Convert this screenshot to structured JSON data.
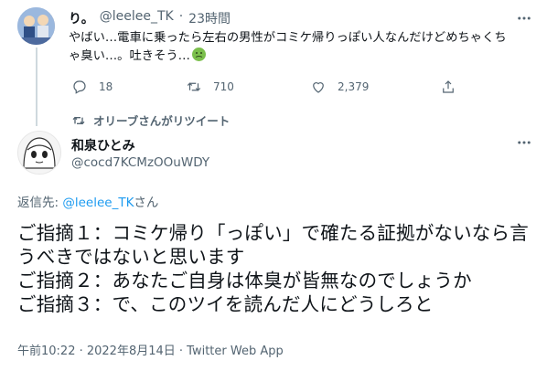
{
  "quoted_tweet": {
    "display_name": "り。",
    "handle": "@leelee_TK",
    "separator": "·",
    "time": "23時間",
    "text": "やばい…電車に乗ったら左右の男性がコミケ帰りっぽい人なんだけどめちゃくちゃ臭い…。吐きそう…",
    "emoji": "nauseated-face",
    "actions": {
      "reply_count": "18",
      "retweet_count": "710",
      "like_count": "2,379"
    }
  },
  "retweet_notice": "オリーブさんがリツイート",
  "main_tweet": {
    "display_name": "和泉ひとみ",
    "handle": "@cocd7KCMzOOuWDY",
    "reply_prefix": "返信先: ",
    "reply_handle": "@leelee_TK",
    "reply_suffix": "さん",
    "text": "ご指摘１：コミケ帰り「っぽい」で確たる証拠がないなら言うべきではないと思います\nご指摘２：あなたご自身は体臭が皆無なのでしょうか\nご指摘３：で、このツイを読んだ人にどうしろと",
    "meta": "午前10:22 · 2022年8月14日 · Twitter Web App"
  },
  "icons": [
    "more-icon",
    "reply-icon",
    "retweet-icon",
    "like-icon",
    "share-icon",
    "nauseated-face-icon"
  ],
  "colors": {
    "text": "#0f1419",
    "muted": "#536471",
    "link": "#1d9bf0",
    "divider": "#cfd9de"
  }
}
